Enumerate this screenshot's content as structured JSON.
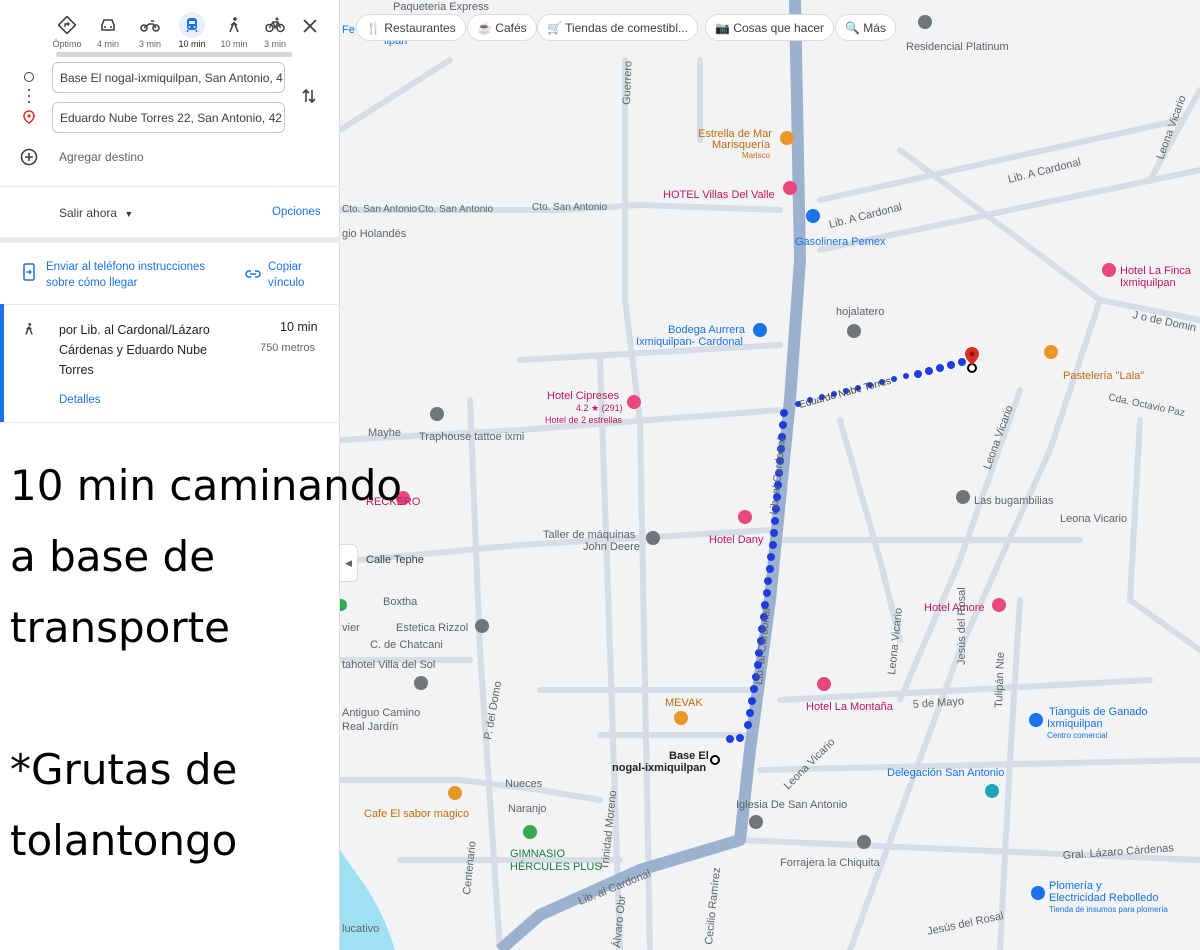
{
  "modes": [
    {
      "icon": "directions-icon",
      "label": "Óptimo",
      "active": false
    },
    {
      "icon": "car-icon",
      "label": "4 min",
      "active": false
    },
    {
      "icon": "motorcycle-icon",
      "label": "3 min",
      "active": false
    },
    {
      "icon": "transit-icon",
      "label": "10 min",
      "active": true
    },
    {
      "icon": "walk-icon",
      "label": "10 min",
      "active": false
    },
    {
      "icon": "bicycle-icon",
      "label": "3 min",
      "active": false
    }
  ],
  "origin": "Base El nogal-ixmiquilpan, San Antonio, 4",
  "destination": "Eduardo Nube Torres 22, San Antonio, 42",
  "add_destination": "Agregar destino",
  "depart": "Salir ahora",
  "options": "Opciones",
  "send_phone": [
    "Enviar al teléfono instrucciones",
    "sobre cómo llegar"
  ],
  "copy_link": [
    "Copiar",
    "vínculo"
  ],
  "route": {
    "via": [
      "por Lib. al Cardonal/Lázaro",
      "Cárdenas y Eduardo Nube",
      "Torres"
    ],
    "time": "10 min",
    "distance": "750 metros",
    "details": "Detalles"
  },
  "note_lines": [
    "10 min caminando",
    "a base de",
    "transporte",
    "",
    "*Grutas de",
    "tolantongo"
  ],
  "chips": [
    {
      "icon": "restaurant-icon",
      "label": "Restaurantes"
    },
    {
      "icon": "cafe-icon",
      "label": "Cafés"
    },
    {
      "icon": "cart-icon",
      "label": "Tiendas de comestibl..."
    },
    {
      "icon": "camera-icon",
      "label": "Cosas que hacer"
    },
    {
      "icon": "search-icon",
      "label": "Más"
    }
  ],
  "colors": {
    "route_blue": "#1a73e8",
    "walk_dots": "#1e3de0",
    "road_main": "#8fa8c8",
    "poi_pink": "#e8477f",
    "poi_orange": "#e8952a",
    "poi_gray": "#70757a",
    "poi_green": "#34a853",
    "water": "#9fe1f2"
  },
  "map_labels": {
    "paqueteria": "Paqueteria Express",
    "residencial": "Residencial Platinum",
    "guerrero": "Guerrero",
    "estrella1": "Estrella de Mar",
    "estrella2": "Marisquería",
    "estrella3": "Marisco",
    "villas": "HOTEL Villas Del Valle",
    "cardonal_e1": "Lib. A Cardonal",
    "cardonal_e2": "Lib. A Cardonal",
    "leona_top": "Leona Vicario",
    "cto1": "Cto. San Antonio",
    "cto2": "Cto. San Antonio",
    "cto3": "Cto. San Antonio",
    "holandes": "gio Holandés",
    "pemex": "Gasolinera Pemex",
    "finca1": "Hotel La Finca",
    "finca2": "Ixmiquilpan",
    "hojalatero": "hojalatero",
    "aurrera1": "Bodega Aurrera",
    "aurrera2": "Ixmiquilpan- Cardonal",
    "domingo": "J o de Domin",
    "lala": "Pastelería \"Lala\"",
    "octavio": "Cda. Octavio Paz",
    "cipreses": "Hotel Cipreses",
    "cipreses_rating": "4.2 ★ (291)",
    "cipreses_sub": "Hotel de 2 estrellas",
    "nube": "Eduardo Nube Torres",
    "leona_mid": "Leona Vicario",
    "mayhe": "Mayhe",
    "traphouse": "Traphouse tattoe ixmi",
    "cardonal_v": "Lib. al Cardonal",
    "bugambilias": "Las bugambilias",
    "leona_r": "Leona Vicario",
    "dany": "Hotel Dany",
    "taller1": "Taller de máquinas",
    "taller2": "John Deere",
    "tephe": "Calle Tephe",
    "boxtha": "Boxtha",
    "estetica": "Estetica Rizzol",
    "chatcani": "C. de Chatcani",
    "villasol": "tahotel Villa del Sol",
    "amore": "Hotel Amore",
    "leona_l": "Leona Vicario",
    "jesus_nte": "Jesús del Rosal",
    "tulipan": "Tulipán Nte",
    "mayo": "5 de Mayo",
    "montana": "Hotel La Montaña",
    "mevak": "MEVAK",
    "cardonal_v2": "Lib. al Cardonal",
    "antiguo1": "Antiguo Camino",
    "antiguo2": "Real Jardín",
    "domo": "P. del Domo",
    "tianguis1": "Tianguis de Ganado",
    "tianguis2": "Ixmiquilpan",
    "tianguis3": "Centro comercial",
    "base1": "Base El",
    "base2": "nogal-ixmiquilpan",
    "leona_low": "Leona Vicario",
    "delegacion": "Delegación San Antonio",
    "nueces": "Nueces",
    "sabor": "Cafe El sabor magico",
    "naranjo": "Naranjo",
    "iglesia": "Iglesia De San Antonio",
    "trinidad": "Trinidad Moreno",
    "gimnasio1": "GIMNASIO",
    "gimnasio2": "HÉRCULES PLUS",
    "centenario": "Centenario",
    "forrajera": "Forrajera la Chiquita",
    "gral": "Gral. Lázaro Cárdenas",
    "plomeria1": "Plomería y",
    "plomeria2": "Electricidad Rebolledo",
    "plomeria3": "Tienda de insumos para plomería",
    "jesus_low": "Jesús del Rosal",
    "cecilio": "Cecilio Ramírez",
    "alvaro": "Álvaro Obr",
    "cardonal_low": "Lib. al Cardonal",
    "lucativo": "lucativo",
    "fer": "Fe",
    "ixmi": "ilpan",
    "vier": "vier",
    "h_label": "RECKERO"
  }
}
